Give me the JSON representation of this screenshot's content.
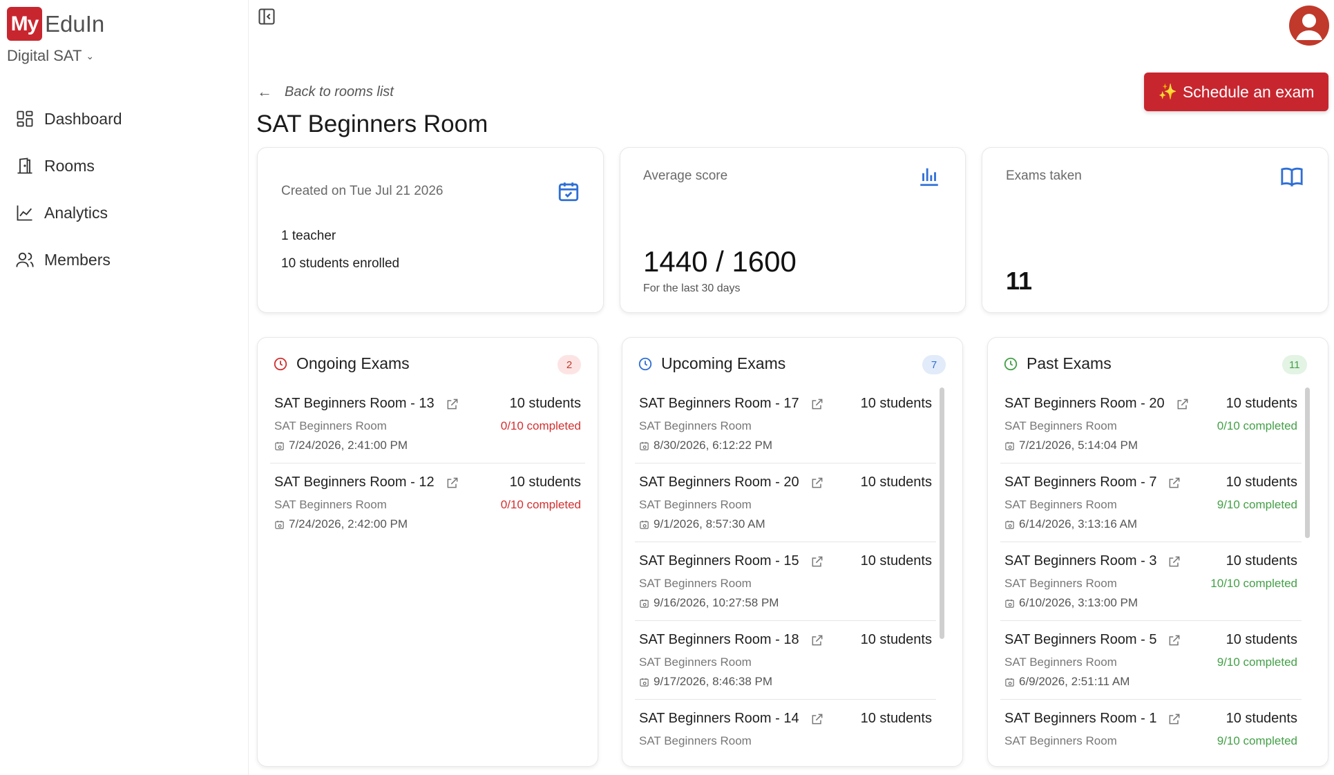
{
  "brand": {
    "logo_mark": "My",
    "logo_text": "EduIn",
    "org": "Digital SAT"
  },
  "nav": [
    {
      "label": "Dashboard",
      "icon": "dashboard-icon"
    },
    {
      "label": "Rooms",
      "icon": "door-icon"
    },
    {
      "label": "Analytics",
      "icon": "line-chart-icon"
    },
    {
      "label": "Members",
      "icon": "users-icon"
    }
  ],
  "header": {
    "back_label": "Back to rooms list",
    "title": "SAT Beginners Room",
    "schedule_label": "Schedule an exam"
  },
  "stats": {
    "created": {
      "label": "Created on Tue Jul 21 2026",
      "teachers": "1 teacher",
      "students": "10 students enrolled",
      "icon": "calendar-check-icon"
    },
    "average": {
      "label": "Average score",
      "value": "1440 / 1600",
      "sub": "For the last 30 days",
      "icon": "bar-chart-icon"
    },
    "exams": {
      "label": "Exams taken",
      "value": "11",
      "icon": "book-open-icon"
    }
  },
  "colors": {
    "accent": "#c8262f",
    "ongoing": "#d32f2f",
    "upcoming": "#2f6fd6",
    "past": "#43a047"
  },
  "panels": {
    "ongoing": {
      "title": "Ongoing Exams",
      "count": "2",
      "rows": [
        {
          "name": "SAT Beginners Room - 13",
          "students": "10 students",
          "room": "SAT Beginners Room",
          "completed": "0/10 completed",
          "date": "7/24/2026, 2:41:00 PM"
        },
        {
          "name": "SAT Beginners Room - 12",
          "students": "10 students",
          "room": "SAT Beginners Room",
          "completed": "0/10 completed",
          "date": "7/24/2026, 2:42:00 PM"
        }
      ]
    },
    "upcoming": {
      "title": "Upcoming Exams",
      "count": "7",
      "rows": [
        {
          "name": "SAT Beginners Room - 17",
          "students": "10 students",
          "room": "SAT Beginners Room",
          "date": "8/30/2026, 6:12:22 PM"
        },
        {
          "name": "SAT Beginners Room - 20",
          "students": "10 students",
          "room": "SAT Beginners Room",
          "date": "9/1/2026, 8:57:30 AM"
        },
        {
          "name": "SAT Beginners Room - 15",
          "students": "10 students",
          "room": "SAT Beginners Room",
          "date": "9/16/2026, 10:27:58 PM"
        },
        {
          "name": "SAT Beginners Room - 18",
          "students": "10 students",
          "room": "SAT Beginners Room",
          "date": "9/17/2026, 8:46:38 PM"
        },
        {
          "name": "SAT Beginners Room - 14",
          "students": "10 students",
          "room": "SAT Beginners Room",
          "date": ""
        }
      ]
    },
    "past": {
      "title": "Past Exams",
      "count": "11",
      "rows": [
        {
          "name": "SAT Beginners Room - 20",
          "students": "10 students",
          "room": "SAT Beginners Room",
          "completed": "0/10 completed",
          "date": "7/21/2026, 5:14:04 PM"
        },
        {
          "name": "SAT Beginners Room - 7",
          "students": "10 students",
          "room": "SAT Beginners Room",
          "completed": "9/10 completed",
          "date": "6/14/2026, 3:13:16 AM"
        },
        {
          "name": "SAT Beginners Room - 3",
          "students": "10 students",
          "room": "SAT Beginners Room",
          "completed": "10/10 completed",
          "date": "6/10/2026, 3:13:00 PM"
        },
        {
          "name": "SAT Beginners Room - 5",
          "students": "10 students",
          "room": "SAT Beginners Room",
          "completed": "9/10 completed",
          "date": "6/9/2026, 2:51:11 AM"
        },
        {
          "name": "SAT Beginners Room - 1",
          "students": "10 students",
          "room": "SAT Beginners Room",
          "completed": "9/10 completed",
          "date": ""
        }
      ]
    }
  }
}
